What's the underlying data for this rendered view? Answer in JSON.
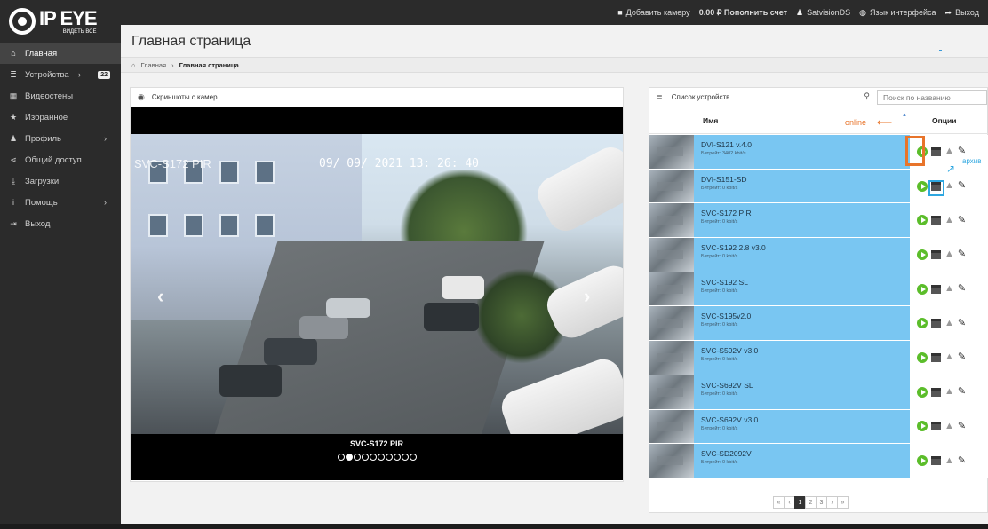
{
  "brand": {
    "logo_text": "IP EYE",
    "logo_subtext": "ВИДЕТЬ ВСЁ"
  },
  "topbar": {
    "add_camera": "Добавить камеру",
    "balance": "0.00 ₽ Пополнить счет",
    "user": "SatvisionDS",
    "language": "Язык интерфейса",
    "logout": "Выход"
  },
  "sidebar": {
    "items": [
      {
        "label": "Главная",
        "icon": "home-icon"
      },
      {
        "label": "Устройства",
        "icon": "list-icon",
        "badge": "22"
      },
      {
        "label": "Видеостены",
        "icon": "grid-icon"
      },
      {
        "label": "Избранное",
        "icon": "star-icon"
      },
      {
        "label": "Профиль",
        "icon": "user-icon"
      },
      {
        "label": "Общий доступ",
        "icon": "share-icon"
      },
      {
        "label": "Загрузки",
        "icon": "download-icon"
      },
      {
        "label": "Помощь",
        "icon": "info-icon"
      },
      {
        "label": "Выход",
        "icon": "logout-icon"
      }
    ]
  },
  "page": {
    "title": "Главная страница",
    "breadcrumb": {
      "home": "Главная",
      "current": "Главная страница"
    }
  },
  "screens": {
    "header": "Скриншоты с камер",
    "osd_name": "SVC-S172 PIR",
    "osd_time": "09/ 09/ 2021 13: 26: 40",
    "caption": "SVC-S172 PIR",
    "dots_total": 10,
    "dot_active": 2
  },
  "devices": {
    "header": "Список устройств",
    "search_placeholder": "Поиск по названию",
    "col_name": "Имя",
    "col_options": "Опции",
    "annotation_online": "online",
    "annotation_archive": "архив",
    "rows": [
      {
        "name": "DVI-S121 v.4.0",
        "bitrate": "Битрейт: 3402 kbit/s"
      },
      {
        "name": "DVI-S151-SD",
        "bitrate": "Битрейт: 0 kbit/s"
      },
      {
        "name": "SVC-S172 PIR",
        "bitrate": "Битрейт: 0 kbit/s"
      },
      {
        "name": "SVC-S192 2.8 v3.0",
        "bitrate": "Битрейт: 0 kbit/s"
      },
      {
        "name": "SVC-S192 SL",
        "bitrate": "Битрейт: 0 kbit/s"
      },
      {
        "name": "SVC-S195v2.0",
        "bitrate": "Битрейт: 0 kbit/s"
      },
      {
        "name": "SVC-S592V v3.0",
        "bitrate": "Битрейт: 0 kbit/s"
      },
      {
        "name": "SVC-S692V SL",
        "bitrate": "Битрейт: 0 kbit/s"
      },
      {
        "name": "SVC-S692V v3.0",
        "bitrate": "Битрейт: 0 kbit/s"
      },
      {
        "name": "SVC-SD2092V",
        "bitrate": "Битрейт: 0 kbit/s"
      }
    ],
    "pagination": {
      "first": "«",
      "prev": "‹",
      "pages": [
        "1",
        "2",
        "3"
      ],
      "next": "›",
      "last": "»",
      "current": "1"
    }
  },
  "colors": {
    "accent_row": "#79c6f2",
    "online_annotation": "#e8742a",
    "archive_annotation": "#2ea7e0",
    "play_green": "#5bbd2a"
  }
}
